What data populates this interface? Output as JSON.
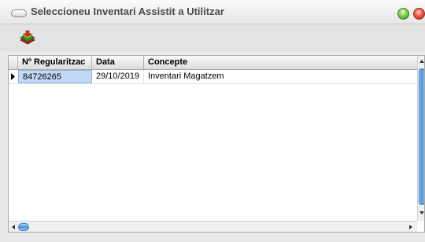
{
  "window": {
    "title": "Seleccioneu Inventari Assistit a Utilitzar"
  },
  "toolbar": {
    "action_icon": "accept-stack-icon"
  },
  "grid": {
    "columns": [
      "Nº Regularitzac",
      "Data",
      "Concepte"
    ],
    "rows": [
      {
        "regularitzacio": "84726265",
        "data": "29/10/2019",
        "concepte": "Inventari Magatzem"
      }
    ],
    "selected_row": 0
  },
  "colors": {
    "selection": "#c3daf6",
    "scroll_thumb": "#4a90d9",
    "close": "#e0452f",
    "zoom": "#5cb832"
  }
}
